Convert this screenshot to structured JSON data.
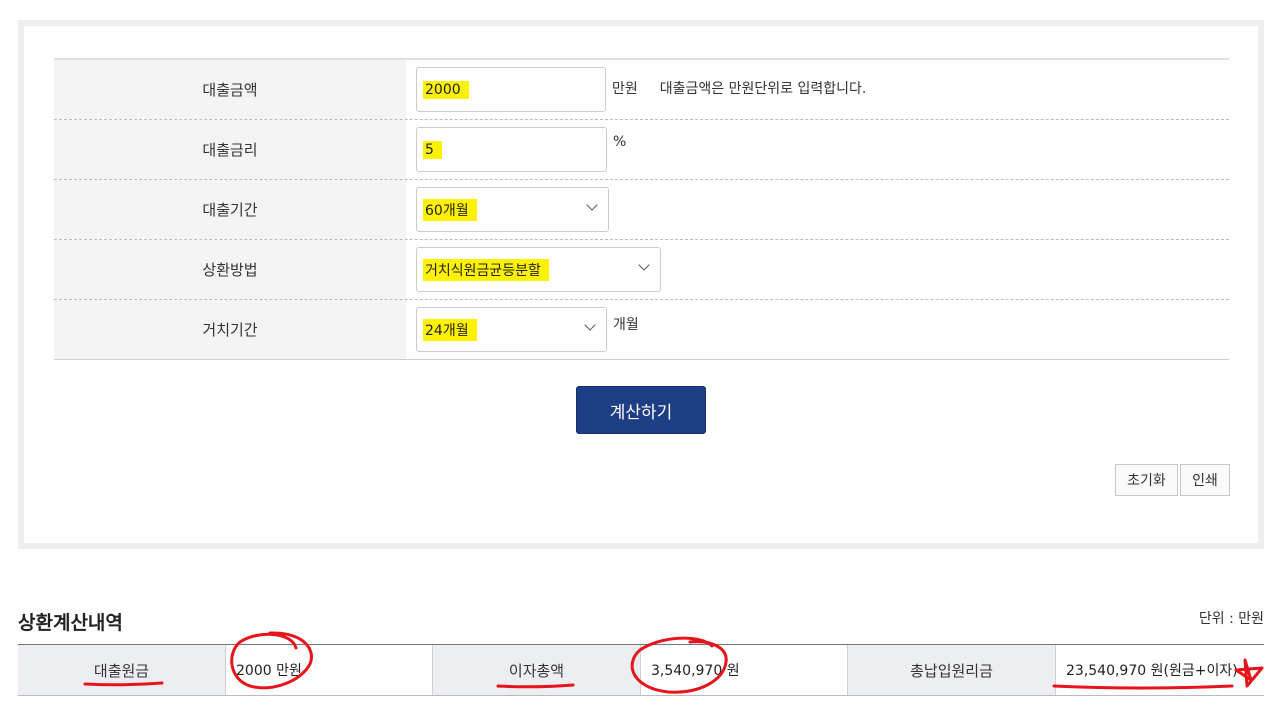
{
  "form": {
    "rows": [
      {
        "label": "대출금액",
        "value": "2000",
        "unit": "만원",
        "hint": "대출금액은 만원단위로 입력합니다."
      },
      {
        "label": "대출금리",
        "value": "5",
        "unit": "%"
      },
      {
        "label": "대출기간",
        "value": "60개월"
      },
      {
        "label": "상환방법",
        "value": "거치식원금균등분할"
      },
      {
        "label": "거치기간",
        "value": "24개월",
        "unit": "개월"
      }
    ]
  },
  "buttons": {
    "calculate": "계산하기",
    "reset": "초기화",
    "print": "인쇄"
  },
  "results": {
    "title": "상환계산내역",
    "unit_note": "단위 : 만원",
    "principal_label": "대출원금",
    "principal_value": "2000 만원",
    "interest_label": "이자총액",
    "interest_value": "3,540,970 원",
    "total_label": "총납입원리금",
    "total_value": "23,540,970 원(원금+이자)"
  },
  "colors": {
    "highlight": "#fff200",
    "annotation": "#e8141b",
    "button": "#1d3e84"
  }
}
